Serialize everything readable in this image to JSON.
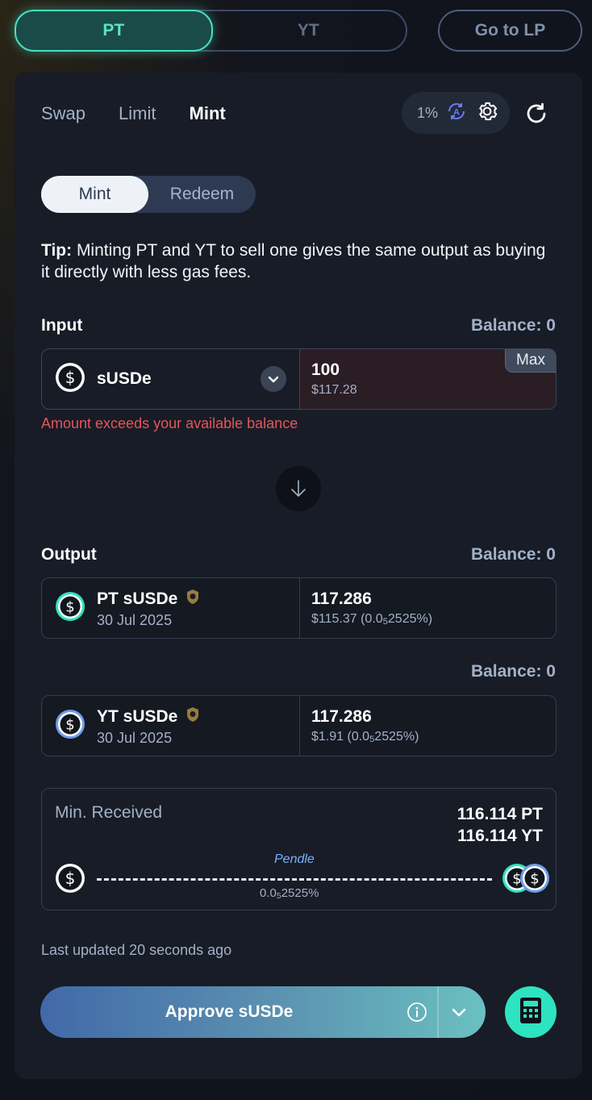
{
  "top": {
    "pt_label": "PT",
    "yt_label": "YT",
    "lp_label": "Go to LP"
  },
  "tabs": [
    {
      "label": "Swap"
    },
    {
      "label": "Limit"
    },
    {
      "label": "Mint"
    }
  ],
  "settings": {
    "slippage": "1%"
  },
  "mint_toggle": {
    "mint": "Mint",
    "redeem": "Redeem"
  },
  "tip": {
    "bold": "Tip:",
    "text": " Minting PT and YT to sell one gives the same output as buying it directly with less gas fees."
  },
  "input": {
    "label": "Input",
    "balance": "Balance: 0",
    "token": "sUSDe",
    "amount": "100",
    "usd": "$117.28",
    "max": "Max",
    "error": "Amount exceeds your available balance"
  },
  "output": {
    "label": "Output",
    "pt": {
      "balance": "Balance: 0",
      "name": "PT sUSDe",
      "date": "30 Jul 2025",
      "amount": "117.286",
      "usd_pre": "$115.37 (0.0",
      "usd_sub": "5",
      "usd_post": "2525%)"
    },
    "yt": {
      "balance": "Balance: 0",
      "name": "YT sUSDe",
      "date": "30 Jul 2025",
      "amount": "117.286",
      "usd_pre": "$1.91 (0.0",
      "usd_sub": "5",
      "usd_post": "2525%)"
    }
  },
  "min_received": {
    "label": "Min. Received",
    "pt": "116.114 PT",
    "yt": "116.114 YT",
    "route_name": "Pendle",
    "route_pre": "0.0",
    "route_sub": "5",
    "route_post": "2525%"
  },
  "updated": "Last updated 20 seconds ago",
  "approve_label": "Approve sUSDe",
  "colors": {
    "accent": "#45e0bf",
    "error": "#e4555a",
    "route": "#7ab0ff"
  }
}
